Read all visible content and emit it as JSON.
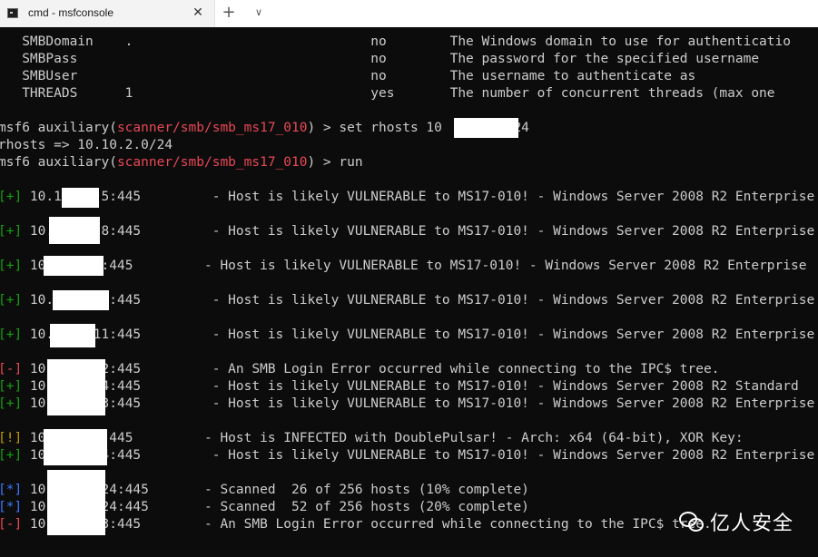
{
  "window": {
    "tab_title": "cmd - msfconsole",
    "close_glyph": "✕",
    "new_tab_glyph": "+",
    "dropdown_glyph": "∨"
  },
  "terminal": {
    "colors": {
      "background": "#0c0c0c",
      "text": "#cccccc",
      "green": "#13a10e",
      "red": "#e74856",
      "blue": "#3b78ff",
      "yellow": "#c19c00"
    },
    "lines": [
      "   SMBDomain    .                              no        The Windows domain to use for authenticatio",
      "   SMBPass                                     no        The password for the specified username",
      "   SMBUser                                     no        The username to authenticate as",
      "   THREADS      1                              yes       The number of concurrent threads (max one",
      "",
      {
        "prefix": "msf6 auxiliary(",
        "module": "scanner/smb/smb_ms17_010",
        "suffix": ") > set rhosts 10         24"
      },
      "rhosts => 10.10.2.0/24",
      {
        "prefix": "msf6 auxiliary(",
        "module": "scanner/smb/smb_ms17_010",
        "suffix": ") > run"
      },
      "",
      {
        "tag": "[+]",
        "color": "green",
        "text": " 10.1     5:445         - Host is likely VULNERABLE to MS17-010! - Windows Server 2008 R2 Enterprise"
      },
      "",
      {
        "tag": "[+]",
        "color": "green",
        "text": " 10.      8:445         - Host is likely VULNERABLE to MS17-010! - Windows Server 2008 R2 Enterprise"
      },
      "",
      {
        "tag": "[+]",
        "color": "green",
        "text": " 10       :445         - Host is likely VULNERABLE to MS17-010! - Windows Server 2008 R2 Enterprise"
      },
      "",
      {
        "tag": "[+]",
        "color": "green",
        "text": " 10.      0:445         - Host is likely VULNERABLE to MS17-010! - Windows Server 2008 R2 Enterprise"
      },
      "",
      {
        "tag": "[+]",
        "color": "green",
        "text": " 10.     11:445         - Host is likely VULNERABLE to MS17-010! - Windows Server 2008 R2 Enterprise"
      },
      "",
      {
        "tag": "[-]",
        "color": "red",
        "text": " 10.      2:445         - An SMB Login Error occurred while connecting to the IPC$ tree."
      },
      {
        "tag": "[+]",
        "color": "green",
        "text": " 10.     14:445         - Host is likely VULNERABLE to MS17-010! - Windows Server 2008 R2 Standard"
      },
      {
        "tag": "[+]",
        "color": "green",
        "text": " 10.      3:445         - Host is likely VULNERABLE to MS17-010! - Windows Server 2008 R2 Enterprise"
      },
      "",
      {
        "tag": "[!]",
        "color": "yellow",
        "text": " 10       :445         - Host is INFECTED with DoublePulsar! - Arch: x64 (64-bit), XOR Key:"
      },
      {
        "tag": "[+]",
        "color": "green",
        "text": " 10.      4:445         - Host is likely VULNERABLE to MS17-010! - Windows Server 2008 R2 Enterprise"
      },
      "",
      {
        "tag": "[*]",
        "color": "blue",
        "text": " 10.     /24:445       - Scanned  26 of 256 hosts (10% complete)"
      },
      {
        "tag": "[*]",
        "color": "blue",
        "text": " 10.     /24:445       - Scanned  52 of 256 hosts (20% complete)"
      },
      {
        "tag": "[-]",
        "color": "red",
        "text": " 10.     53:445        - An SMB Login Error occurred while connecting to the IPC$ tree."
      }
    ]
  },
  "watermark": {
    "text": "亿人安全"
  }
}
